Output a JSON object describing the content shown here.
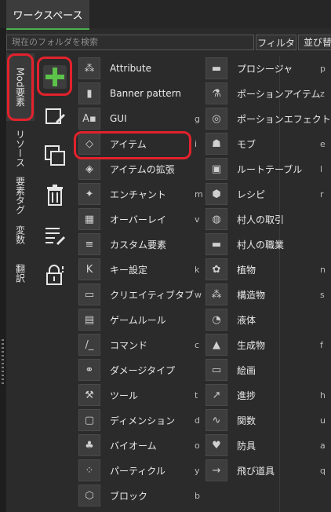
{
  "workspace_tab": "ワークスペース",
  "search": {
    "placeholder": "現在のフォルダを検索"
  },
  "filter_label": "フィルタ",
  "sort_label": "並び替え",
  "vertical_tabs": [
    "Mod要素",
    "リソース",
    "要素タグ",
    "変数",
    "翻訳"
  ],
  "active_vertical_tab": "Mod要素",
  "tools": [
    "add-icon",
    "edit-icon",
    "duplicate-icon",
    "trash-icon",
    "list-edit-icon",
    "lock-icon"
  ],
  "left_column": [
    {
      "label": "Attribute",
      "key": "",
      "icon": "attribute-icon"
    },
    {
      "label": "Banner pattern",
      "key": "",
      "icon": "banner-icon"
    },
    {
      "label": "GUI",
      "key": "g",
      "icon": "gui-icon"
    },
    {
      "label": "アイテム",
      "key": "i",
      "icon": "diamond-icon"
    },
    {
      "label": "アイテムの拡張",
      "key": "",
      "icon": "item-extension-icon"
    },
    {
      "label": "エンチャント",
      "key": "m",
      "icon": "enchant-icon"
    },
    {
      "label": "オーバーレイ",
      "key": "v",
      "icon": "overlay-icon"
    },
    {
      "label": "カスタム要素",
      "key": "",
      "icon": "custom-element-icon"
    },
    {
      "label": "キー設定",
      "key": "k",
      "icon": "keybind-icon"
    },
    {
      "label": "クリエイティブタブ",
      "key": "w",
      "icon": "creative-tab-icon"
    },
    {
      "label": "ゲームルール",
      "key": "",
      "icon": "gamerule-icon"
    },
    {
      "label": "コマンド",
      "key": "c",
      "icon": "command-icon"
    },
    {
      "label": "ダメージタイプ",
      "key": "",
      "icon": "damage-type-icon"
    },
    {
      "label": "ツール",
      "key": "t",
      "icon": "pickaxe-icon"
    },
    {
      "label": "ディメンション",
      "key": "d",
      "icon": "dimension-icon"
    },
    {
      "label": "バイオーム",
      "key": "o",
      "icon": "biome-icon"
    },
    {
      "label": "パーティクル",
      "key": "y",
      "icon": "particle-icon"
    },
    {
      "label": "ブロック",
      "key": "b",
      "icon": "block-icon"
    }
  ],
  "right_column": [
    {
      "label": "プロシージャ",
      "key": "p",
      "icon": "folder-icon"
    },
    {
      "label": "ポーションアイテム",
      "key": "z",
      "icon": "flask-icon"
    },
    {
      "label": "ポーションエフェクト",
      "key": "",
      "icon": "potion-effect-icon"
    },
    {
      "label": "モブ",
      "key": "e",
      "icon": "mob-icon"
    },
    {
      "label": "ルートテーブル",
      "key": "l",
      "icon": "loot-table-icon"
    },
    {
      "label": "レシピ",
      "key": "r",
      "icon": "recipe-icon"
    },
    {
      "label": "村人の取引",
      "key": "",
      "icon": "villager-trade-icon"
    },
    {
      "label": "村人の職業",
      "key": "",
      "icon": "villager-profession-icon"
    },
    {
      "label": "植物",
      "key": "n",
      "icon": "plant-icon"
    },
    {
      "label": "構造物",
      "key": "s",
      "icon": "structure-icon"
    },
    {
      "label": "液体",
      "key": "",
      "icon": "fluid-icon"
    },
    {
      "label": "生成物",
      "key": "f",
      "icon": "feature-icon"
    },
    {
      "label": "絵画",
      "key": "",
      "icon": "painting-icon"
    },
    {
      "label": "進捗",
      "key": "h",
      "icon": "advancement-icon"
    },
    {
      "label": "関数",
      "key": "u",
      "icon": "function-icon"
    },
    {
      "label": "防具",
      "key": "a",
      "icon": "armor-icon"
    },
    {
      "label": "飛び道具",
      "key": "q",
      "icon": "projectile-icon"
    }
  ],
  "colors": {
    "accent": "#4caf50",
    "highlight": "#e2222c",
    "background": "#2b2b2b"
  }
}
